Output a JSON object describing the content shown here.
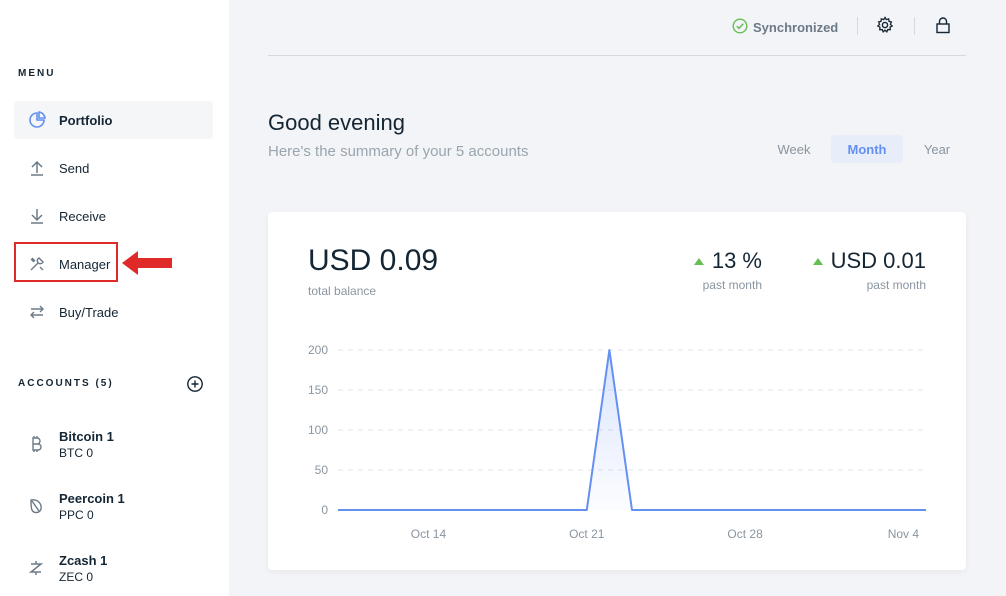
{
  "sidebar": {
    "menu_title": "MENU",
    "items": [
      {
        "label": "Portfolio",
        "icon": "pie-chart-icon"
      },
      {
        "label": "Send",
        "icon": "arrow-up-icon"
      },
      {
        "label": "Receive",
        "icon": "arrow-down-icon"
      },
      {
        "label": "Manager",
        "icon": "tools-icon"
      },
      {
        "label": "Buy/Trade",
        "icon": "swap-icon"
      }
    ],
    "accounts_title": "ACCOUNTS (5)",
    "accounts": [
      {
        "name": "Bitcoin 1",
        "balance": "BTC 0",
        "icon": "bitcoin-icon"
      },
      {
        "name": "Peercoin 1",
        "balance": "PPC 0",
        "icon": "peercoin-icon"
      },
      {
        "name": "Zcash 1",
        "balance": "ZEC 0",
        "icon": "zcash-icon"
      }
    ]
  },
  "header": {
    "sync_label": "Synchronized"
  },
  "greeting": {
    "title": "Good evening",
    "summary": "Here's the summary of your 5 accounts"
  },
  "ranges": [
    "Week",
    "Month",
    "Year"
  ],
  "selected_range": "Month",
  "card": {
    "balance": "USD 0.09",
    "balance_label": "total balance",
    "stats": [
      {
        "value": "13 %",
        "label": "past month"
      },
      {
        "value": "USD 0.01",
        "label": "past month"
      }
    ]
  },
  "colors": {
    "accent": "#6490f1",
    "positive": "#66be54",
    "highlight": "#e02a2a"
  },
  "chart_data": {
    "type": "area",
    "y_ticks": [
      0,
      50,
      100,
      150,
      200
    ],
    "x_ticks": [
      "Oct 14",
      "Oct 21",
      "Oct 28",
      "Nov 4"
    ],
    "ylim": [
      0,
      200
    ],
    "series": [
      {
        "x": [
          "Oct 10",
          "Oct 11",
          "Oct 12",
          "Oct 13",
          "Oct 14",
          "Oct 15",
          "Oct 16",
          "Oct 17",
          "Oct 18",
          "Oct 19",
          "Oct 20",
          "Oct 21",
          "Oct 22",
          "Oct 23",
          "Oct 24",
          "Oct 25",
          "Oct 26",
          "Oct 27",
          "Oct 28",
          "Oct 29",
          "Oct 30",
          "Oct 31",
          "Nov 1",
          "Nov 2",
          "Nov 3",
          "Nov 4",
          "Nov 5"
        ],
        "values": [
          0,
          0,
          0,
          0,
          0,
          0,
          0,
          0,
          0,
          0,
          0,
          0,
          200,
          0,
          0,
          0,
          0,
          0,
          0,
          0,
          0,
          0,
          0,
          0,
          0,
          0,
          0
        ]
      }
    ],
    "grid": true,
    "legend": "none"
  }
}
